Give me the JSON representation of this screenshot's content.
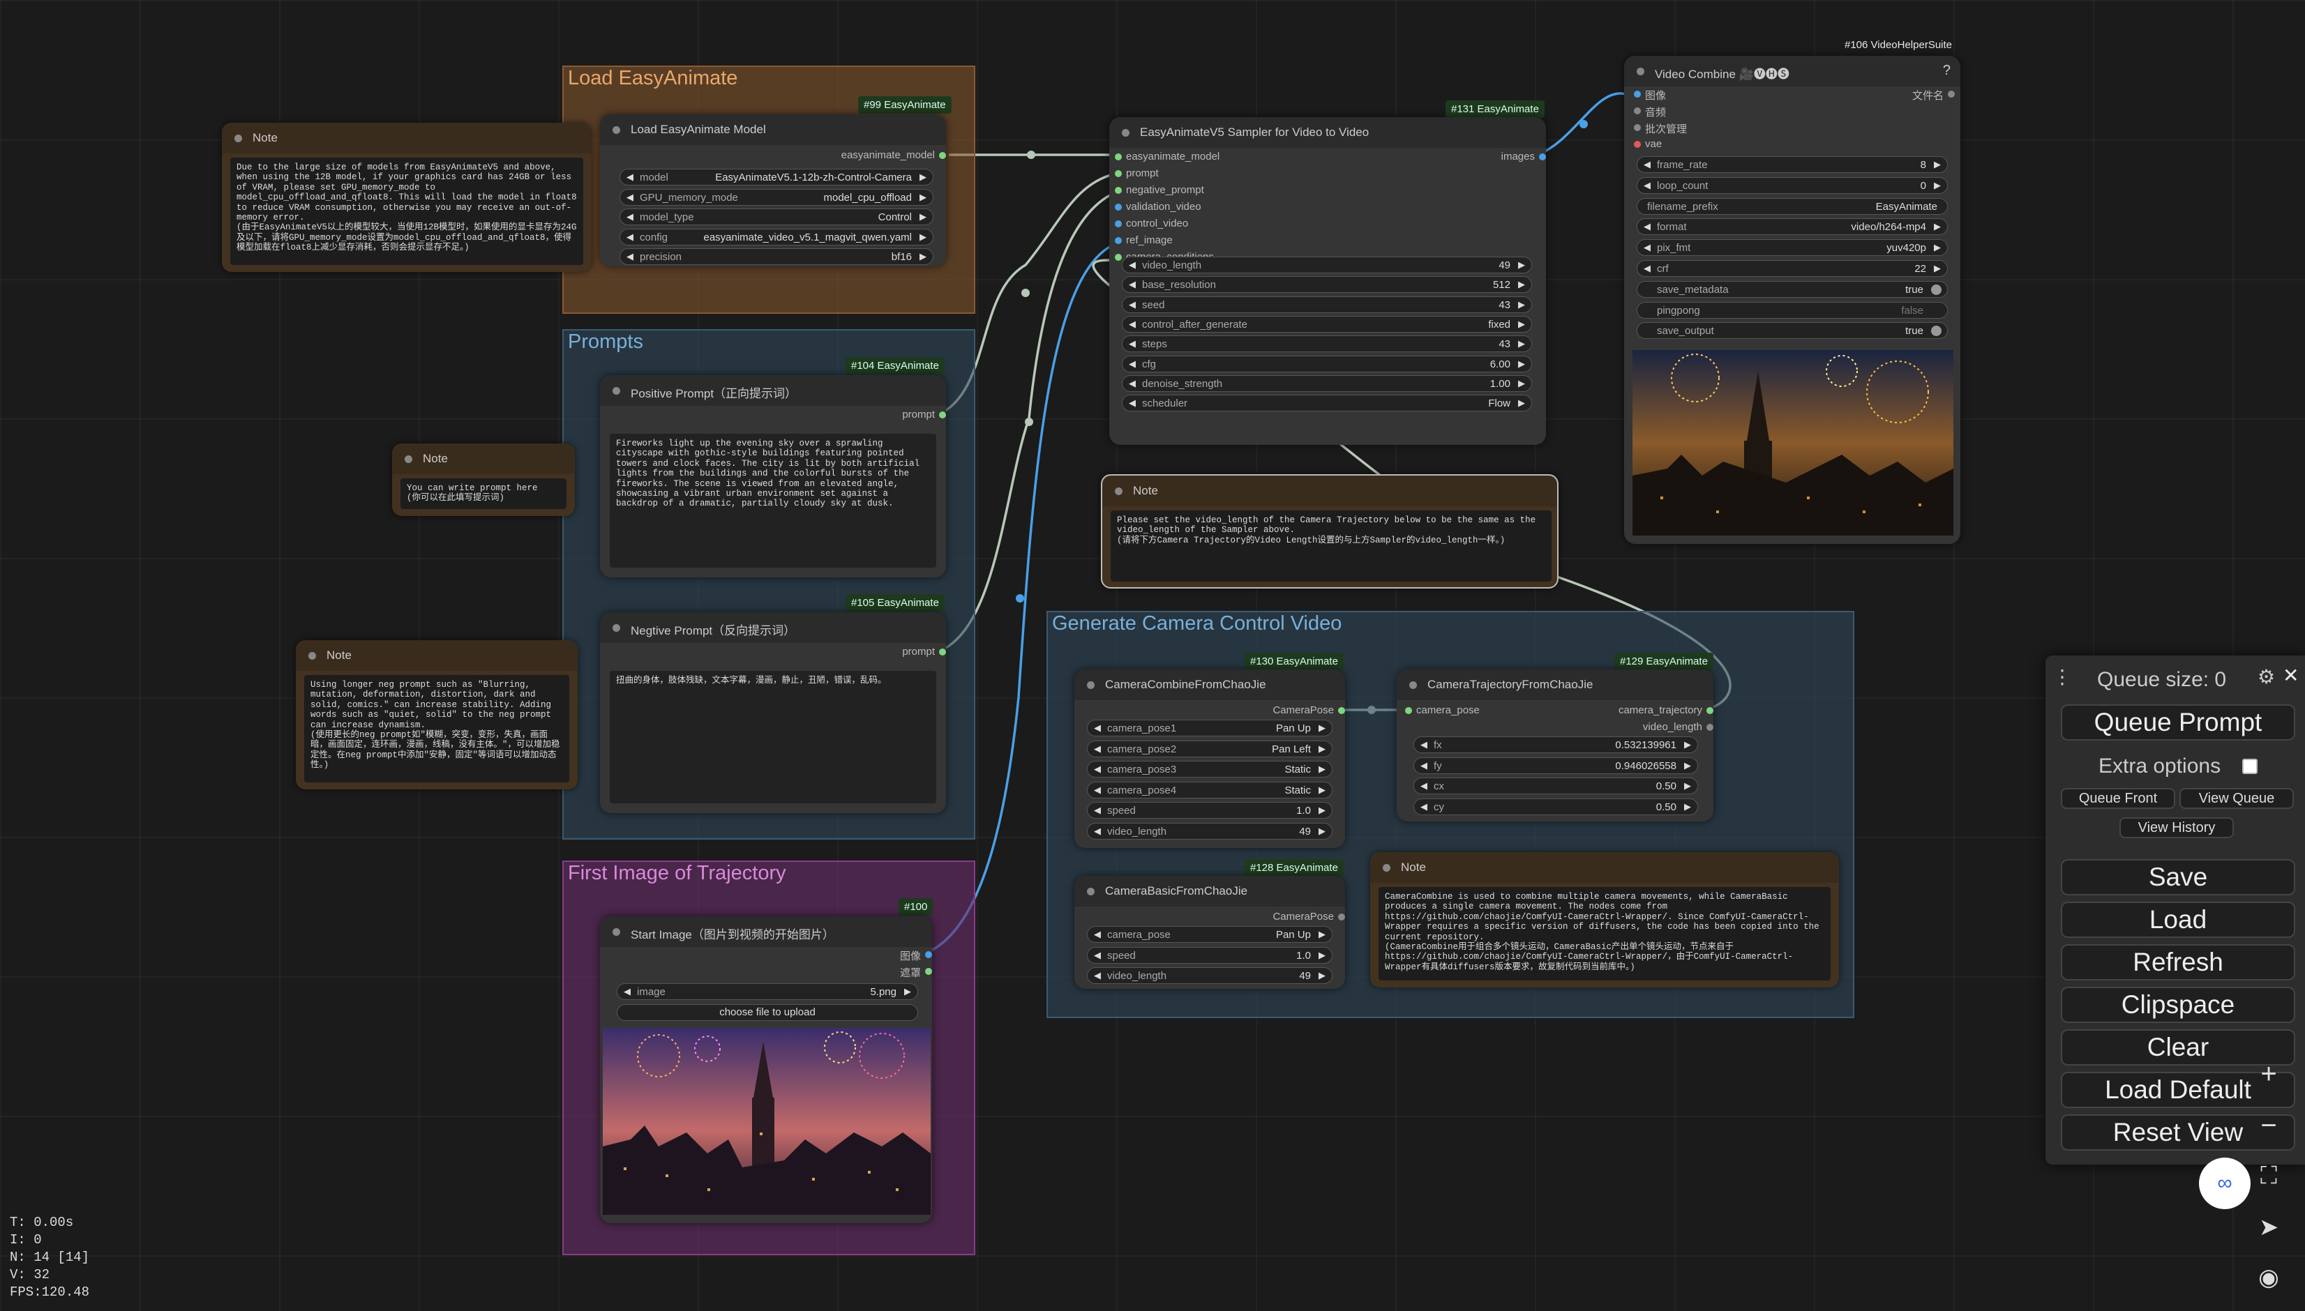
{
  "groups": {
    "load": {
      "title": "Load EasyAnimate"
    },
    "prompts": {
      "title": "Prompts"
    },
    "first_image": {
      "title": "First Image of Trajectory"
    },
    "camera": {
      "title": "Generate Camera Control Video"
    }
  },
  "notes": {
    "n1": {
      "title": "Note",
      "text": "Due to the large size of models from EasyAnimateV5 and above, when using the 12B model, if your graphics card has 24GB or less of VRAM, please set GPU_memory_mode to model_cpu_offload_and_qfloat8. This will load the model in float8 to reduce VRAM consumption, otherwise you may receive an out-of-memory error.\n(由于EasyAnimateV5以上的模型较大，当使用12B模型时，如果使用的显卡显存为24G及以下，请将GPU_memory_mode设置为model_cpu_offload_and_qfloat8，使得模型加载在float8上减少显存消耗，否则会提示显存不足。)"
    },
    "n2": {
      "title": "Note",
      "text": "You can write prompt here\n(你可以在此填写提示词)"
    },
    "n3": {
      "title": "Note",
      "text": "Using longer neg prompt such as \"Blurring, mutation, deformation, distortion, dark and solid, comics.\" can increase stability. Adding words such as \"quiet, solid\" to the neg prompt can increase dynamism.\n(使用更长的neg prompt如\"模糊，突变，变形，失真，画面暗，画面固定，连环画，漫画，线稿，没有主体。\"，可以增加稳定性。在neg prompt中添加\"安静，固定\"等词语可以增加动态性。)"
    },
    "n4": {
      "title": "Note",
      "text": "Please set the video_length of the Camera Trajectory below to be the same as the video_length of the Sampler above.\n(请将下方Camera Trajectory的Video Length设置的与上方Sampler的video_length一样。)"
    },
    "n5": {
      "title": "Note",
      "text": "CameraCombine is used to combine multiple camera movements, while CameraBasic produces a single camera movement. The nodes come from https://github.com/chaojie/ComfyUI-CameraCtrl-Wrapper/. Since ComfyUI-CameraCtrl-Wrapper requires a specific version of diffusers, the code has been copied into the current repository.\n(CameraCombine用于组合多个镜头运动，CameraBasic产出单个镜头运动，节点来自于https://github.com/chaojie/ComfyUI-CameraCtrl-Wrapper/，由于ComfyUI-CameraCtrl-Wrapper有具体diffusers版本要求，故复制代码到当前库中。)"
    }
  },
  "load_model": {
    "badge": "#99 EasyAnimate",
    "title": "Load EasyAnimate Model",
    "output": "easyanimate_model",
    "widgets": [
      {
        "label": "model",
        "value": "EasyAnimateV5.1-12b-zh-Control-Camera"
      },
      {
        "label": "GPU_memory_mode",
        "value": "model_cpu_offload"
      },
      {
        "label": "model_type",
        "value": "Control"
      },
      {
        "label": "config",
        "value": "easyanimate_video_v5.1_magvit_qwen.yaml"
      },
      {
        "label": "precision",
        "value": "bf16"
      }
    ]
  },
  "positive": {
    "badge": "#104 EasyAnimate",
    "title": "Positive Prompt（正向提示词）",
    "output": "prompt",
    "text": "Fireworks light up the evening sky over a sprawling cityscape with gothic-style buildings featuring pointed towers and clock faces. The city is lit by both artificial lights from the buildings and the colorful bursts of the fireworks. The scene is viewed from an elevated angle, showcasing a vibrant urban environment set against a backdrop of a dramatic, partially cloudy sky at dusk."
  },
  "negative": {
    "badge": "#105 EasyAnimate",
    "title": "Negtive Prompt（反向提示词）",
    "output": "prompt",
    "text": "扭曲的身体，肢体残缺，文本字幕，漫画，静止，丑陋，错误，乱码。"
  },
  "start_image": {
    "badge": "#100",
    "title": "Start Image（图片到视频的开始图片）",
    "out1": "图像",
    "out2": "遮罩",
    "widget": {
      "label": "image",
      "value": "5.png"
    },
    "upload": "choose file to upload"
  },
  "sampler": {
    "badge": "#131 EasyAnimate",
    "title": "EasyAnimateV5 Sampler for Video to Video",
    "inputs": [
      "easyanimate_model",
      "prompt",
      "negative_prompt",
      "validation_video",
      "control_video",
      "ref_image",
      "camera_conditions"
    ],
    "output": "images",
    "widgets": [
      {
        "label": "video_length",
        "value": "49"
      },
      {
        "label": "base_resolution",
        "value": "512"
      },
      {
        "label": "seed",
        "value": "43"
      },
      {
        "label": "control_after_generate",
        "value": "fixed"
      },
      {
        "label": "steps",
        "value": "43"
      },
      {
        "label": "cfg",
        "value": "6.00"
      },
      {
        "label": "denoise_strength",
        "value": "1.00"
      },
      {
        "label": "scheduler",
        "value": "Flow"
      }
    ]
  },
  "video_combine": {
    "badge": "#106 VideoHelperSuite",
    "title": "Video Combine 🎥🅥🅗🅢",
    "help": "?",
    "inputs": [
      "图像",
      "音频",
      "批次管理",
      "vae"
    ],
    "output": "文件名",
    "widgets": [
      {
        "label": "frame_rate",
        "value": "8",
        "kind": "arrow"
      },
      {
        "label": "loop_count",
        "value": "0",
        "kind": "arrow"
      },
      {
        "label": "filename_prefix",
        "value": "EasyAnimate",
        "kind": "text"
      },
      {
        "label": "format",
        "value": "video/h264-mp4",
        "kind": "arrow"
      },
      {
        "label": "pix_fmt",
        "value": "yuv420p",
        "kind": "arrow"
      },
      {
        "label": "crf",
        "value": "22",
        "kind": "arrow"
      },
      {
        "label": "save_metadata",
        "value": "true",
        "kind": "toggle"
      },
      {
        "label": "pingpong",
        "value": "false",
        "kind": "toggle"
      },
      {
        "label": "save_output",
        "value": "true",
        "kind": "toggle"
      }
    ]
  },
  "cam_combine": {
    "badge": "#130 EasyAnimate",
    "title": "CameraCombineFromChaoJie",
    "output": "CameraPose",
    "widgets": [
      {
        "label": "camera_pose1",
        "value": "Pan Up"
      },
      {
        "label": "camera_pose2",
        "value": "Pan Left"
      },
      {
        "label": "camera_pose3",
        "value": "Static"
      },
      {
        "label": "camera_pose4",
        "value": "Static"
      },
      {
        "label": "speed",
        "value": "1.0"
      },
      {
        "label": "video_length",
        "value": "49"
      }
    ]
  },
  "cam_basic": {
    "badge": "#128 EasyAnimate",
    "title": "CameraBasicFromChaoJie",
    "output": "CameraPose",
    "widgets": [
      {
        "label": "camera_pose",
        "value": "Pan Up"
      },
      {
        "label": "speed",
        "value": "1.0"
      },
      {
        "label": "video_length",
        "value": "49"
      }
    ]
  },
  "cam_traj": {
    "badge": "#129 EasyAnimate",
    "title": "CameraTrajectoryFromChaoJie",
    "input": "camera_pose",
    "out1": "camera_trajectory",
    "out2": "video_length",
    "widgets": [
      {
        "label": "fx",
        "value": "0.532139961"
      },
      {
        "label": "fy",
        "value": "0.946026558"
      },
      {
        "label": "cx",
        "value": "0.50"
      },
      {
        "label": "cy",
        "value": "0.50"
      }
    ]
  },
  "panel": {
    "queue_size": "Queue size: 0",
    "queue_prompt": "Queue Prompt",
    "extra_options": "Extra options",
    "queue_front": "Queue Front",
    "view_queue": "View Queue",
    "view_history": "View History",
    "save": "Save",
    "load": "Load",
    "refresh": "Refresh",
    "clipspace": "Clipspace",
    "clear": "Clear",
    "load_default": "Load Default",
    "reset_view": "Reset View",
    "menu_icon": "⋮",
    "gear_icon": "⚙",
    "close_icon": "✕"
  },
  "stats": {
    "t": "T: 0.00s",
    "i": "I: 0",
    "n": "N: 14 [14]",
    "v": "V: 32",
    "fps": "FPS:120.48"
  },
  "colors": {
    "link": "#c8d8c8",
    "blue_link": "#4a9fe8",
    "group_load": "#8a5a2e",
    "group_prompt": "#2f4a5e",
    "group_image": "#6b2e6b",
    "group_camera": "#2f4a5e"
  }
}
